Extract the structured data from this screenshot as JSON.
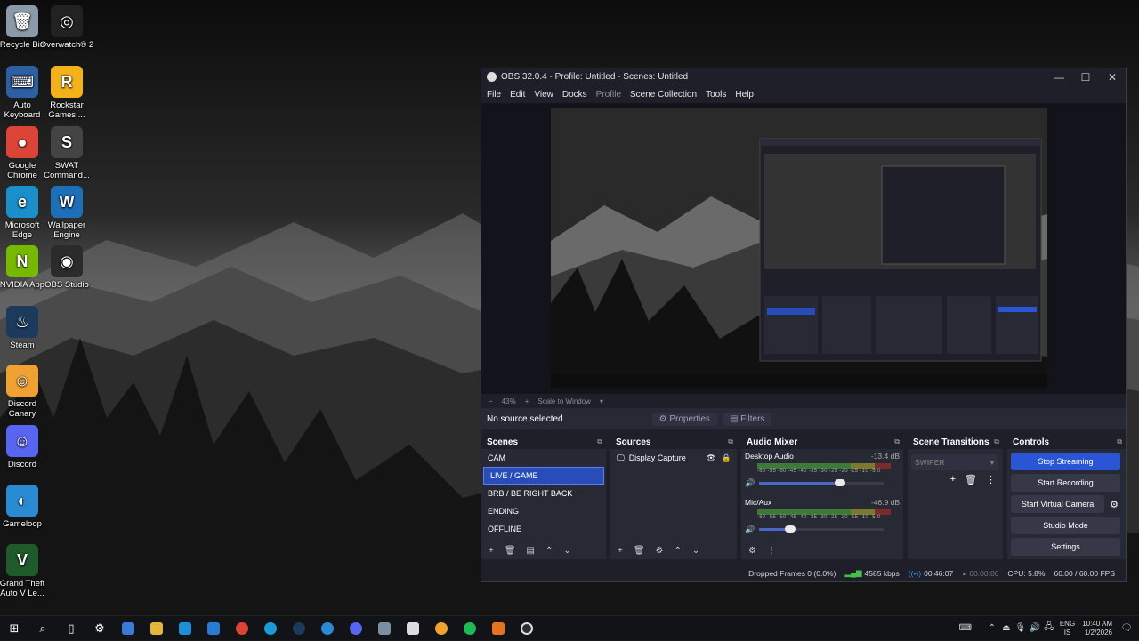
{
  "desktop": {
    "icons": [
      {
        "label": "Recycle Bin",
        "glyph": "🗑",
        "color": "#8a9aa8"
      },
      {
        "label": "Overwatch® 2",
        "glyph": "◎",
        "color": "#222"
      },
      {
        "label": "Auto Keyboard",
        "glyph": "⌨",
        "color": "#2d5fa3"
      },
      {
        "label": "Rockstar Games ...",
        "glyph": "R",
        "color": "#f3b21a"
      },
      {
        "label": "Google Chrome",
        "glyph": "●",
        "color": "#db4437"
      },
      {
        "label": "SWAT Command...",
        "glyph": "S",
        "color": "#444"
      },
      {
        "label": "Microsoft Edge",
        "glyph": "e",
        "color": "#1a8fc9"
      },
      {
        "label": "Wallpaper Engine",
        "glyph": "W",
        "color": "#1d6fb8"
      },
      {
        "label": "NVIDIA App",
        "glyph": "N",
        "color": "#76b900"
      },
      {
        "label": "OBS Studio",
        "glyph": "◉",
        "color": "#2b2b2b"
      },
      {
        "label": "Steam",
        "glyph": "♨",
        "color": "#1b3a5c"
      },
      {
        "label": "Discord Canary",
        "glyph": "☺",
        "color": "#f0a132"
      },
      {
        "label": "Discord",
        "glyph": "☺",
        "color": "#5865f2"
      },
      {
        "label": "Gameloop",
        "glyph": "◐",
        "color": "#2a8ad4"
      },
      {
        "label": "Grand Theft Auto V Le...",
        "glyph": "V",
        "color": "#1f5a2a"
      }
    ]
  },
  "obs": {
    "title": "OBS 32.0.4 - Profile: Untitled - Scenes: Untitled",
    "menu": [
      "File",
      "Edit",
      "View",
      "Docks",
      "Profile",
      "Scene Collection",
      "Tools",
      "Help"
    ],
    "zoom": "43%",
    "scale_mode": "Scale to Window",
    "no_source": "No source selected",
    "properties": "Properties",
    "filters": "Filters",
    "scenes": {
      "title": "Scenes",
      "items": [
        "CAM",
        "LIVE / GAME",
        "BRB / BE RIGHT BACK",
        "ENDING",
        "OFFLINE"
      ],
      "selected": 1
    },
    "sources": {
      "title": "Sources",
      "items": [
        "Display Capture"
      ]
    },
    "audio": {
      "title": "Audio Mixer",
      "channels": [
        {
          "name": "Desktop Audio",
          "db": "-13.4 dB",
          "level": 0.65
        },
        {
          "name": "Mic/Aux",
          "db": "-46.9 dB",
          "level": 0.25
        }
      ],
      "ticks": "-60 -55 -50 -45 -40 -35 -30 -25 -20 -15 -10 -5 0"
    },
    "transitions": {
      "title": "Scene Transitions",
      "selected": "SWIPER"
    },
    "controls": {
      "title": "Controls",
      "buttons": [
        "Stop Streaming",
        "Start Recording",
        "Start Virtual Camera",
        "Studio Mode",
        "Settings"
      ]
    },
    "status": {
      "dropped": "Dropped Frames 0 (0.0%)",
      "bitrate": "4585 kbps",
      "stream_time": "00:46:07",
      "rec_time": "00:00:00",
      "cpu": "CPU: 5.8%",
      "fps": "60.00 / 60.00 FPS"
    }
  },
  "taskbar": {
    "lang": "ENG",
    "region": "IS",
    "time": "10:40 AM",
    "date": "1/2/2026"
  }
}
